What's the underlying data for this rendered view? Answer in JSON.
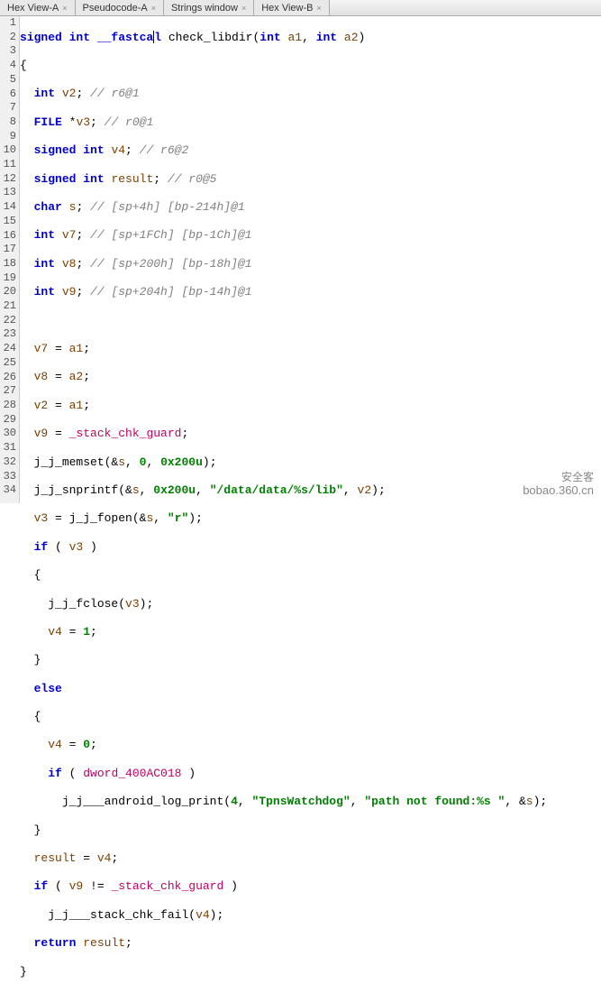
{
  "tabs": [
    {
      "label": "Hex View-A",
      "close": "×"
    },
    {
      "label": "Pseudocode-A",
      "close": "×"
    },
    {
      "label": "Strings window",
      "close": "×"
    },
    {
      "label": "Hex View-B",
      "close": "×"
    }
  ],
  "watermark": {
    "line1": "安全客",
    "line2": "bobao.360.cn"
  },
  "code": {
    "l1": {
      "sig_pre": "signed int __fastca",
      "sig_post": "l ",
      "fn": "check_libdir",
      "args": "(",
      "t1": "int",
      "a1": " a1",
      "c1": ", ",
      "t2": "int",
      "a2": " a2",
      "cl": ")"
    },
    "l2": "{",
    "l3": {
      "ty": "int",
      "sp": " ",
      "id": "v2",
      "sc": "; ",
      "cm": "// r6@1"
    },
    "l4": {
      "ty": "FILE",
      "sp": " *",
      "id": "v3",
      "sc": "; ",
      "cm": "// r0@1"
    },
    "l5": {
      "ty": "signed int",
      "sp": " ",
      "id": "v4",
      "sc": "; ",
      "cm": "// r6@2"
    },
    "l6": {
      "ty": "signed int",
      "sp": " ",
      "id": "result",
      "sc": "; ",
      "cm": "// r0@5"
    },
    "l7": {
      "ty": "char",
      "sp": " ",
      "id": "s",
      "sc": "; ",
      "cm": "// [sp+4h] [bp-214h]@1"
    },
    "l8": {
      "ty": "int",
      "sp": " ",
      "id": "v7",
      "sc": "; ",
      "cm": "// [sp+1FCh] [bp-1Ch]@1"
    },
    "l9": {
      "ty": "int",
      "sp": " ",
      "id": "v8",
      "sc": "; ",
      "cm": "// [sp+200h] [bp-18h]@1"
    },
    "l10": {
      "ty": "int",
      "sp": " ",
      "id": "v9",
      "sc": "; ",
      "cm": "// [sp+204h] [bp-14h]@1"
    },
    "l12": {
      "lhs": "v7",
      "eq": " = ",
      "rhs": "a1",
      "sc": ";"
    },
    "l13": {
      "lhs": "v8",
      "eq": " = ",
      "rhs": "a2",
      "sc": ";"
    },
    "l14": {
      "lhs": "v2",
      "eq": " = ",
      "rhs": "a1",
      "sc": ";"
    },
    "l15": {
      "lhs": "v9",
      "eq": " = ",
      "rhs": "_stack_chk_guard",
      "sc": ";"
    },
    "l16": {
      "fn": "j_j_memset",
      "op": "(&",
      "a1": "s",
      "c1": ", ",
      "a2": "0",
      "c2": ", ",
      "a3": "0x200u",
      "cl": ");"
    },
    "l17": {
      "fn": "j_j_snprintf",
      "op": "(&",
      "a1": "s",
      "c1": ", ",
      "a2": "0x200u",
      "c2": ", ",
      "a3": "\"/data/data/%s/lib\"",
      "c3": ", ",
      "a4": "v2",
      "cl": ");"
    },
    "l18": {
      "lhs": "v3",
      "eq": " = ",
      "fn": "j_j_fopen",
      "op": "(&",
      "a1": "s",
      "c1": ", ",
      "a2": "\"r\"",
      "cl": ");"
    },
    "l19": {
      "kw": "if",
      "sp": " ( ",
      "c": "v3",
      "cl": " )"
    },
    "l20": "{",
    "l21": {
      "fn": "j_j_fclose",
      "op": "(",
      "a1": "v3",
      "cl": ");"
    },
    "l22": {
      "lhs": "v4",
      "eq": " = ",
      "rhs": "1",
      "sc": ";"
    },
    "l23": "}",
    "l24": {
      "kw": "else"
    },
    "l25": "{",
    "l26": {
      "lhs": "v4",
      "eq": " = ",
      "rhs": "0",
      "sc": ";"
    },
    "l27": {
      "kw": "if",
      "sp": " ( ",
      "c": "dword_400AC018",
      "cl": " )"
    },
    "l28": {
      "fn": "j_j___android_log_print",
      "op": "(",
      "a1": "4",
      "c1": ", ",
      "a2": "\"TpnsWatchdog\"",
      "c2": ", ",
      "a3": "\"path not found:%s \"",
      "c3": ", &",
      "a4": "s",
      "cl": ");"
    },
    "l29": "}",
    "l30": {
      "lhs": "result",
      "eq": " = ",
      "rhs": "v4",
      "sc": ";"
    },
    "l31": {
      "kw": "if",
      "sp": " ( ",
      "c1": "v9",
      "ne": " != ",
      "c2": "_stack_chk_guard",
      "cl": " )"
    },
    "l32": {
      "fn": "j_j___stack_chk_fail",
      "op": "(",
      "a1": "v4",
      "cl": ");"
    },
    "l33": {
      "kw": "return",
      "sp": " ",
      "id": "result",
      "sc": ";"
    },
    "l34": "}"
  }
}
